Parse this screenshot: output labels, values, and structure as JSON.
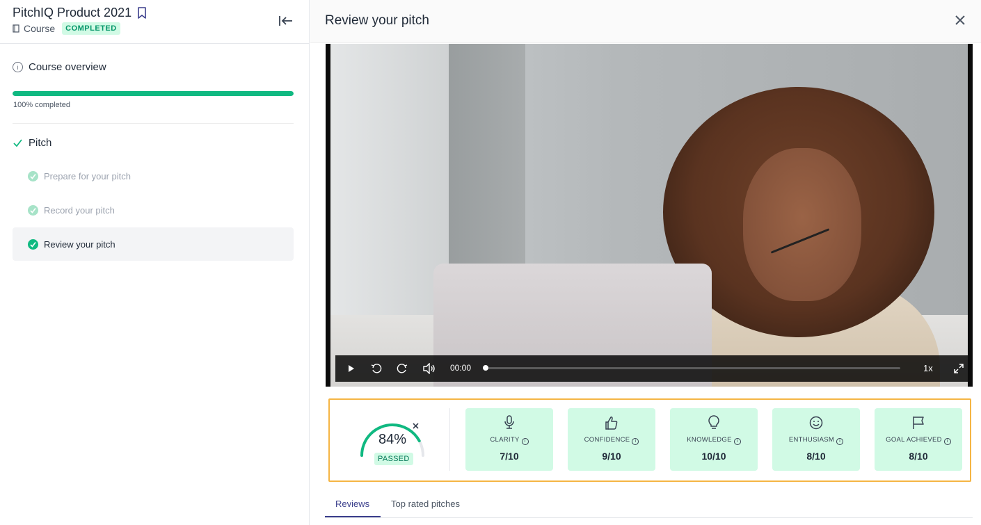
{
  "sidebar": {
    "course_title": "PitchIQ Product 2021",
    "course_type": "Course",
    "status_badge": "COMPLETED",
    "overview_label": "Course overview",
    "progress_percent": 100,
    "progress_label": "100% completed",
    "section_label": "Pitch",
    "steps": [
      {
        "label": "Prepare for your pitch",
        "active": false
      },
      {
        "label": "Record your pitch",
        "active": false
      },
      {
        "label": "Review your pitch",
        "active": true
      }
    ]
  },
  "main": {
    "title": "Review your pitch",
    "video": {
      "time": "00:00",
      "speed": "1x",
      "progress_percent": 0
    },
    "score": {
      "percent": 84,
      "percent_label": "84%",
      "status": "PASSED"
    },
    "metrics": [
      {
        "icon": "microphone-icon",
        "label": "CLARITY",
        "value": "7/10"
      },
      {
        "icon": "thumbs-up-icon",
        "label": "CONFIDENCE",
        "value": "9/10"
      },
      {
        "icon": "lightbulb-icon",
        "label": "KNOWLEDGE",
        "value": "10/10"
      },
      {
        "icon": "smiley-icon",
        "label": "ENTHUSIASM",
        "value": "8/10"
      },
      {
        "icon": "flag-icon",
        "label": "GOAL ACHIEVED",
        "value": "8/10"
      }
    ],
    "tabs": [
      {
        "label": "Reviews",
        "active": true
      },
      {
        "label": "Top rated pitches",
        "active": false
      }
    ]
  },
  "colors": {
    "accent_green": "#10b981",
    "badge_bg": "#d1fae5",
    "highlight_border": "#f5b544",
    "tab_active": "#3b3f8c"
  }
}
